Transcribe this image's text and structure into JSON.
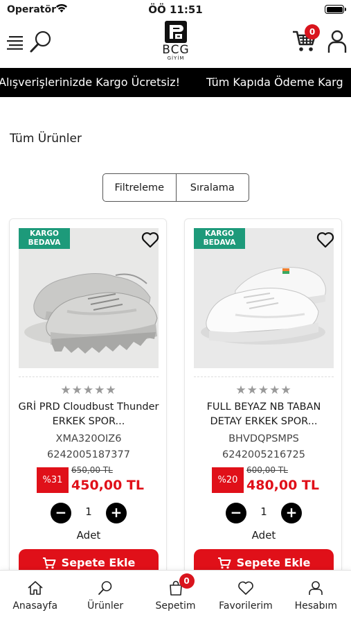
{
  "status_bar": {
    "carrier": "Operatör",
    "time": "ÖÖ 11:51"
  },
  "header": {
    "logo_text": "BCG",
    "logo_sub": "GİYİM",
    "cart_count": "0"
  },
  "marquee": [
    "Alışverişlerinizde Kargo Ücretsiz!",
    "Tüm Kapıda Ödeme Karg"
  ],
  "page_title": "Tüm Ürünler",
  "controls": {
    "filter_label": "Filtreleme",
    "sort_label": "Sıralama"
  },
  "products": [
    {
      "badge": "KARGO BEDAVA",
      "badge_line1": "KARGO",
      "badge_line2": "BEDAVA",
      "rating_stars": "★★★★★",
      "name": "GRİ PRD Cloudbust Thunder ERKEK SPOR...",
      "code": "XMA320OIZ6",
      "barcode": "6242005187377",
      "discount": "%31",
      "old_price": "650,00 TL",
      "new_price": "450,00 TL",
      "quantity": "1",
      "unit": "Adet",
      "add_label": "Sepete Ekle"
    },
    {
      "badge": "KARGO BEDAVA",
      "badge_line1": "KARGO",
      "badge_line2": "BEDAVA",
      "rating_stars": "★★★★★",
      "name": "FULL BEYAZ NB TABAN DETAY ERKEK SPOR...",
      "code": "BHVDQPSMPS",
      "barcode": "6242005216725",
      "discount": "%20",
      "old_price": "600,00 TL",
      "new_price": "480,00 TL",
      "quantity": "1",
      "unit": "Adet",
      "add_label": "Sepete Ekle"
    }
  ],
  "tabbar": {
    "items": [
      {
        "label": "Anasayfa",
        "icon": "home-icon"
      },
      {
        "label": "Ürünler",
        "icon": "search-icon"
      },
      {
        "label": "Sepetim",
        "icon": "bag-icon",
        "badge": "0"
      },
      {
        "label": "Favorilerim",
        "icon": "heart-icon"
      },
      {
        "label": "Hesabım",
        "icon": "user-icon"
      }
    ]
  },
  "colors": {
    "accent_red": "#e01019",
    "badge_green": "#1d9a7a",
    "marquee_bg": "#000000"
  }
}
